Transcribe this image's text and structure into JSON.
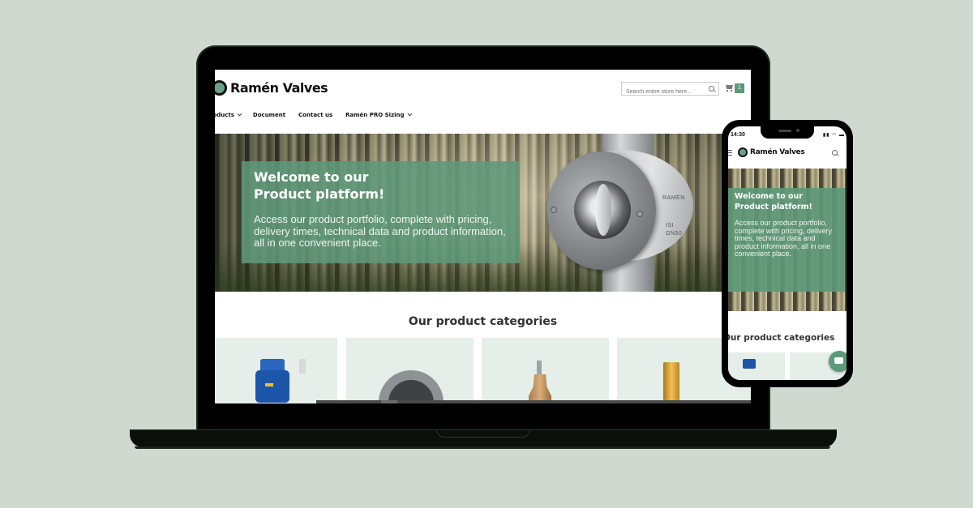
{
  "brand": {
    "name": "Ramén Valves",
    "accent_color": "#5c9a7b",
    "background_color": "#cfd9d0"
  },
  "desktop": {
    "header": {
      "search_placeholder": "Search entire store here...",
      "cart_count": "1",
      "nav": [
        {
          "label": "Products",
          "visible_label": "roducts",
          "has_dropdown": true
        },
        {
          "label": "Document",
          "has_dropdown": false
        },
        {
          "label": "Contact us",
          "has_dropdown": false
        },
        {
          "label": "Ramén PRO Sizing",
          "has_dropdown": true
        }
      ]
    },
    "hero": {
      "title_line1": "Welcome to our",
      "title_line2": "Product platform!",
      "text": "Access our product portfolio, complete with pricing, delivery times, technical data and product information, all in one convenient place.",
      "product_engraving": {
        "brand": "RAMÉN",
        "line1": "ISI",
        "line2": "GN50"
      }
    },
    "categories": {
      "title": "Our product categories",
      "items": [
        {
          "image": "actuated-valve-blue"
        },
        {
          "image": "wafer-ring-valve"
        },
        {
          "image": "bronze-valve"
        },
        {
          "image": "brass-cylinder"
        }
      ]
    }
  },
  "mobile": {
    "status_bar": {
      "time": "14:30",
      "icons": "signal wifi battery"
    },
    "hero": {
      "title_line1": "Welcome to our",
      "title_line2": "Product platform!",
      "text": "Access our product portfolio, complete with pricing, delivery times, technical data and product information, all in one convenient place."
    },
    "categories_title": "Our product categories",
    "chat_button_icon": "chat-icon"
  }
}
